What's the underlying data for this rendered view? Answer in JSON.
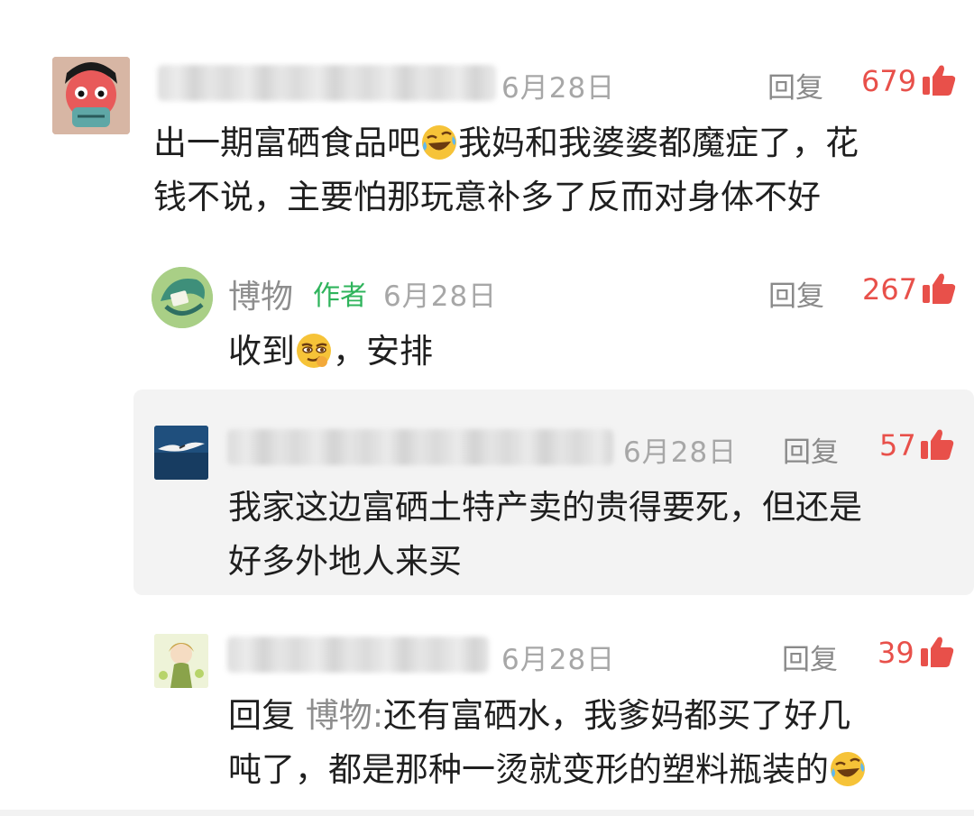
{
  "comments": [
    {
      "id": "c1",
      "date": "6月28日",
      "reply_label": "回复",
      "likes": "679",
      "lines": [
        "出一期富硒食品吧",
        "我妈和我婆婆都魔症了，花",
        "钱不说，主要怕那玩意补多了反而对身体不好"
      ],
      "emoji": "laugh-cry-emoji"
    },
    {
      "id": "c2",
      "author": "博物",
      "author_tag": "作者",
      "date": "6月28日",
      "reply_label": "回复",
      "likes": "267",
      "text_before": "收到",
      "text_after": "，安排",
      "emoji": "smirk-emoji"
    },
    {
      "id": "c3",
      "date": "6月28日",
      "reply_label": "回复",
      "likes": "57",
      "lines": [
        "我家这边富硒土特产卖的贵得要死，但还是",
        "好多外地人来买"
      ]
    },
    {
      "id": "c4",
      "date": "6月28日",
      "reply_label": "回复",
      "likes": "39",
      "reply_prefix": "回复",
      "reply_target": "博物:",
      "lines": [
        "还有富硒水，我爹妈都买了好几",
        "吨了，都是那种一烫就变形的塑料瓶装的"
      ],
      "emoji": "laugh-cry-emoji"
    }
  ],
  "colors": {
    "like_red": "#e8504a",
    "author_green": "#2fb45c",
    "meta_gray": "#a7a7a7",
    "panel_bg": "#f3f3f3"
  }
}
